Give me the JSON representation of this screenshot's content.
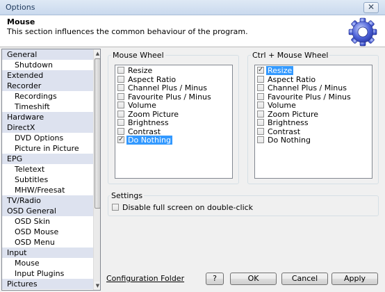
{
  "window": {
    "title": "Options",
    "close_glyph": "✕"
  },
  "header": {
    "title": "Mouse",
    "description": "This section influences the common behaviour of the program.",
    "icon": "gear-icon"
  },
  "sidebar": {
    "items": [
      {
        "label": "General",
        "level": 0
      },
      {
        "label": "Shutdown",
        "level": 1
      },
      {
        "label": "Extended",
        "level": 0
      },
      {
        "label": "Recorder",
        "level": 0
      },
      {
        "label": "Recordings",
        "level": 1
      },
      {
        "label": "Timeshift",
        "level": 1
      },
      {
        "label": "Hardware",
        "level": 0
      },
      {
        "label": "DirectX",
        "level": 0
      },
      {
        "label": "DVD Options",
        "level": 1
      },
      {
        "label": "Picture in Picture",
        "level": 1
      },
      {
        "label": "EPG",
        "level": 0
      },
      {
        "label": "Teletext",
        "level": 1
      },
      {
        "label": "Subtitles",
        "level": 1
      },
      {
        "label": "MHW/Freesat",
        "level": 1
      },
      {
        "label": "TV/Radio",
        "level": 0
      },
      {
        "label": "OSD General",
        "level": 0
      },
      {
        "label": "OSD Skin",
        "level": 1
      },
      {
        "label": "OSD Mouse",
        "level": 1
      },
      {
        "label": "OSD Menu",
        "level": 1
      },
      {
        "label": "Input",
        "level": 0
      },
      {
        "label": "Mouse",
        "level": 1
      },
      {
        "label": "Input Plugins",
        "level": 1
      },
      {
        "label": "Pictures",
        "level": 0
      }
    ],
    "scroll_up": "▲",
    "scroll_down": "▼"
  },
  "mouse_wheel": {
    "label": "Mouse Wheel",
    "options": [
      {
        "label": "Resize",
        "checked": false,
        "selected": false
      },
      {
        "label": "Aspect Ratio",
        "checked": false,
        "selected": false
      },
      {
        "label": "Channel Plus / Minus",
        "checked": false,
        "selected": false
      },
      {
        "label": "Favourite Plus / Minus",
        "checked": false,
        "selected": false
      },
      {
        "label": "Volume",
        "checked": false,
        "selected": false
      },
      {
        "label": "Zoom Picture",
        "checked": false,
        "selected": false
      },
      {
        "label": "Brightness",
        "checked": false,
        "selected": false
      },
      {
        "label": "Contrast",
        "checked": false,
        "selected": false
      },
      {
        "label": "Do Nothing",
        "checked": true,
        "selected": true
      }
    ]
  },
  "ctrl_mouse_wheel": {
    "label": "Ctrl + Mouse Wheel",
    "options": [
      {
        "label": "Resize",
        "checked": true,
        "selected": true
      },
      {
        "label": "Aspect Ratio",
        "checked": false,
        "selected": false
      },
      {
        "label": "Channel Plus / Minus",
        "checked": false,
        "selected": false
      },
      {
        "label": "Favourite Plus / Minus",
        "checked": false,
        "selected": false
      },
      {
        "label": "Volume",
        "checked": false,
        "selected": false
      },
      {
        "label": "Zoom Picture",
        "checked": false,
        "selected": false
      },
      {
        "label": "Brightness",
        "checked": false,
        "selected": false
      },
      {
        "label": "Contrast",
        "checked": false,
        "selected": false
      },
      {
        "label": "Do Nothing",
        "checked": false,
        "selected": false
      }
    ]
  },
  "settings": {
    "label": "Settings",
    "disable_fullscreen_label": "Disable full screen on double-click",
    "disable_fullscreen_checked": false
  },
  "footer": {
    "config_folder_link": "Configuration Folder",
    "help_label": "?",
    "ok_label": "OK",
    "cancel_label": "Cancel",
    "apply_label": "Apply"
  },
  "colors": {
    "selection": "#3399ff",
    "category_bg": "#dde2ef",
    "title_text": "#1e395b"
  }
}
